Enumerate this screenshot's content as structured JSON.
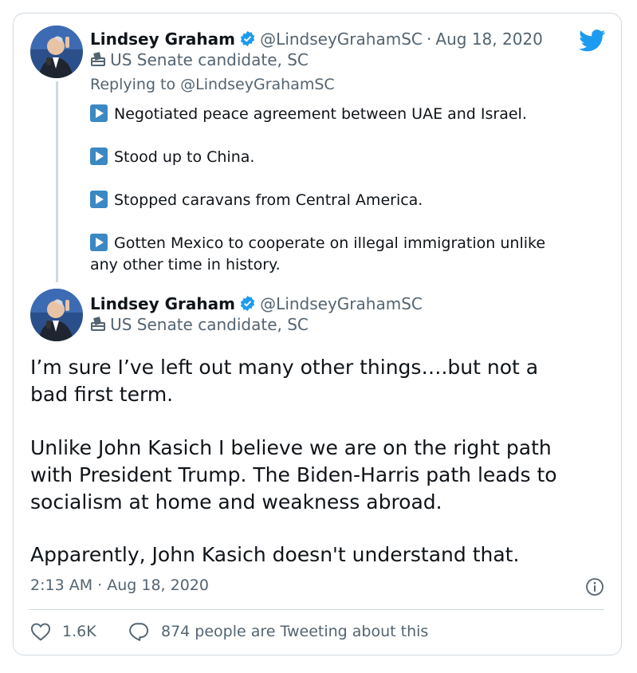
{
  "reply_tweet": {
    "name": "Lindsey Graham",
    "handle": "@LindseyGrahamSC",
    "dot": "·",
    "date": "Aug 18, 2020",
    "label": "US Senate candidate, SC",
    "replying_prefix": "Replying to",
    "replying_handle": "@LindseyGrahamSC",
    "bullets": [
      "Negotiated peace agreement between UAE and Israel.",
      "Stood up to China.",
      "Stopped caravans from Central America.",
      "Gotten Mexico to cooperate on illegal immigration unlike",
      "any other time in history."
    ]
  },
  "main_tweet": {
    "name": "Lindsey Graham",
    "handle": "@LindseyGrahamSC",
    "label": "US Senate candidate, SC",
    "lines": [
      "I’m sure I’ve left out many other things….but not a",
      "bad first term.",
      "Unlike John Kasich I believe we are on the right path",
      "with President Trump. The Biden-Harris path leads to",
      "socialism at home and weakness abroad.",
      "Apparently, John Kasich doesn't understand that."
    ],
    "timestamp": "2:13 AM · Aug 18, 2020",
    "likes": "1.6K",
    "tweeting": "874 people are Tweeting about this"
  },
  "colors": {
    "twitter_blue": "#1d9bf0",
    "text": "#0f1419",
    "secondary": "#536471",
    "border": "#cfd9de",
    "emoji_blue": "#3b88c3"
  }
}
